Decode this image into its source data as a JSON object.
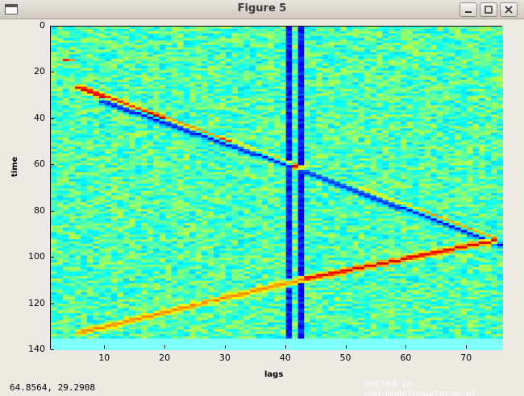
{
  "window": {
    "title": "Figure 5",
    "buttons": {
      "minimize": "minimize",
      "maximize": "maximize",
      "close": "close"
    }
  },
  "status": {
    "coordinates": "64.8564,  29.2908",
    "watermark": "hosted on www.modelbouwforum.nl"
  },
  "chart_data": {
    "type": "heatmap",
    "title": "",
    "xlabel": "lags",
    "ylabel": "time",
    "xlim": [
      1,
      76
    ],
    "ylim": [
      140,
      0
    ],
    "y_reversed": true,
    "x_ticks": [
      "10",
      "20",
      "30",
      "40",
      "50",
      "60",
      "70"
    ],
    "y_ticks": [
      "0",
      "20",
      "40",
      "60",
      "80",
      "100",
      "120",
      "140"
    ],
    "colormap": "jet",
    "background_value": 0.45,
    "n_rows": 135,
    "n_cols": 75,
    "features": [
      {
        "kind": "band",
        "axis": "column",
        "at": 39,
        "value": 0.05
      },
      {
        "kind": "band",
        "axis": "column",
        "at": 41,
        "value": 0.05
      },
      {
        "kind": "ridge",
        "from": [
          4,
          26
        ],
        "to": [
          73,
          92
        ],
        "value": 0.95
      },
      {
        "kind": "ridge",
        "from": [
          8,
          32
        ],
        "to": [
          39,
          60
        ],
        "value": 0.12
      },
      {
        "kind": "ridge",
        "from": [
          41,
          62
        ],
        "to": [
          74,
          94
        ],
        "value": 0.12
      },
      {
        "kind": "ridge",
        "from": [
          41,
          109
        ],
        "to": [
          73,
          92
        ],
        "value": 0.92
      },
      {
        "kind": "ridge",
        "from": [
          4,
          132
        ],
        "to": [
          41,
          109
        ],
        "value": 0.75
      },
      {
        "kind": "spot",
        "at": [
          2,
          14
        ],
        "value": 0.9
      }
    ]
  }
}
